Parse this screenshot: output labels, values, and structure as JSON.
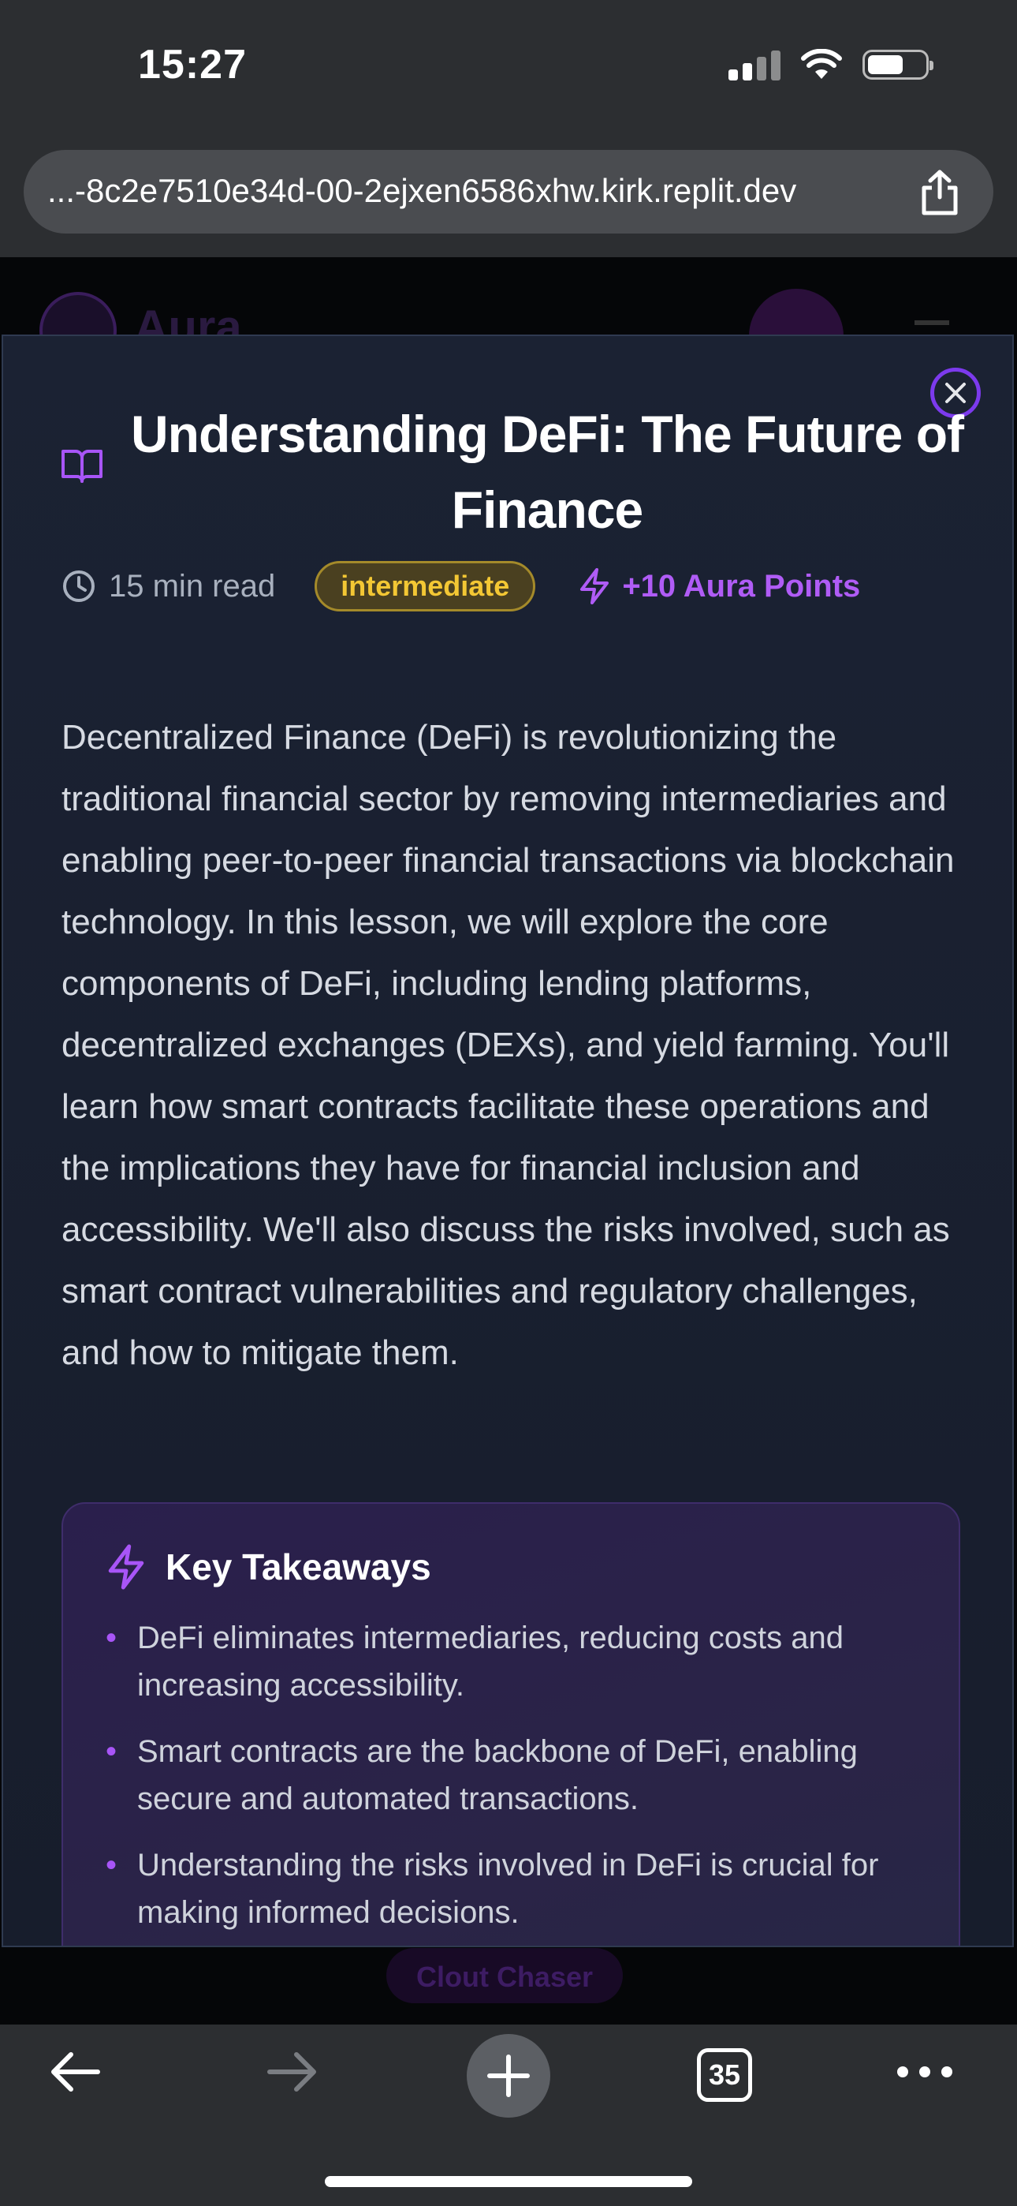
{
  "status_bar": {
    "time": "15:27"
  },
  "browser": {
    "url": "...-8c2e7510e34d-00-2ejxen6586xhw.kirk.replit.dev",
    "tab_count": "35"
  },
  "background_page": {
    "brand": "Aura",
    "footer_pill": "Clout Chaser"
  },
  "lesson": {
    "title": "Understanding DeFi: The Future of Finance",
    "read_time": "15 min read",
    "level": "intermediate",
    "points": "+10 Aura Points",
    "content": "Decentralized Finance (DeFi) is revolutionizing the traditional financial sector by removing intermediaries and enabling peer-to-peer financial transactions via blockchain technology. In this lesson, we will explore the core components of DeFi, including lending platforms, decentralized exchanges (DEXs), and yield farming. You'll learn how smart contracts facilitate these operations and the implications they have for financial inclusion and accessibility. We'll also discuss the risks involved, such as smart contract vulnerabilities and regulatory challenges, and how to mitigate them.",
    "takeaways_title": "Key Takeaways",
    "takeaways": [
      "DeFi eliminates intermediaries, reducing costs and increasing accessibility.",
      "Smart contracts are the backbone of DeFi, enabling secure and automated transactions.",
      "Understanding the risks involved in DeFi is crucial for making informed decisions."
    ]
  },
  "colors": {
    "accent_purple": "#a855f7",
    "badge_yellow": "#f3c734",
    "modal_bg": "#1b2233"
  },
  "icons": {
    "close": "close-icon",
    "book": "book-open-icon",
    "clock": "clock-icon",
    "bolt": "lightning-bolt-icon",
    "share": "share-icon",
    "back": "arrow-left-icon",
    "forward": "arrow-right-icon",
    "new_tab": "plus-icon",
    "more": "more-dots-icon"
  }
}
